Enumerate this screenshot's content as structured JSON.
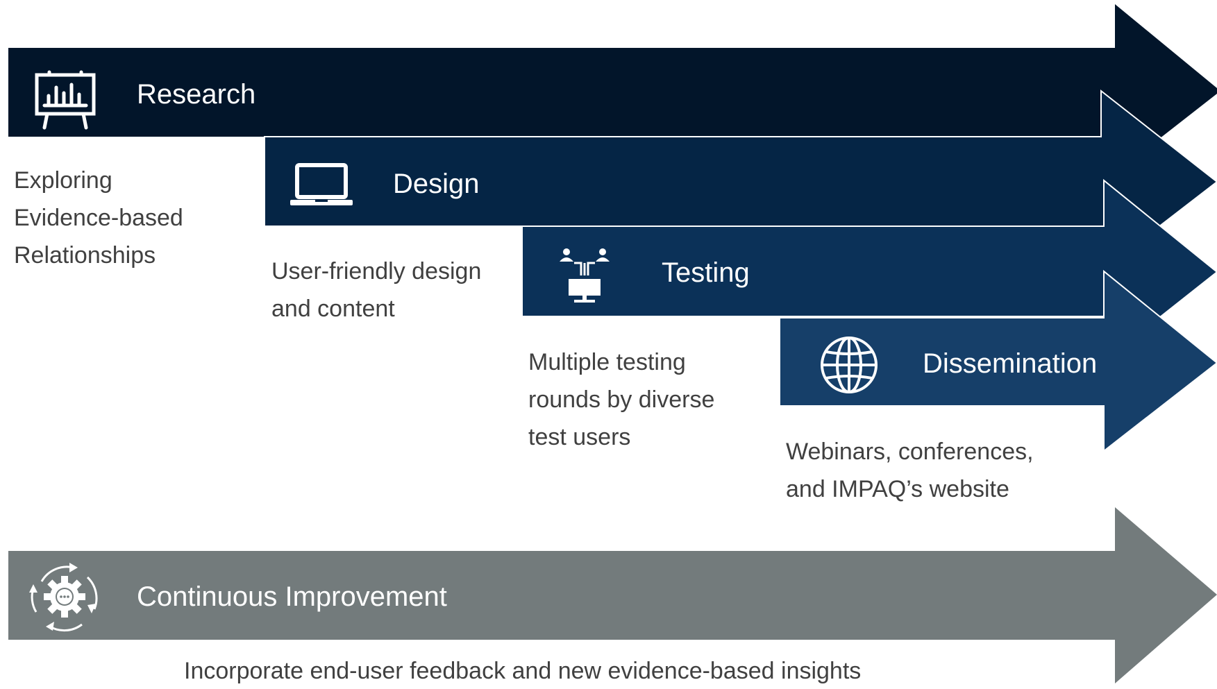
{
  "diagram": {
    "stages": [
      {
        "title": "Research",
        "icon": "presentation-chart-icon",
        "color": "#02152a",
        "description": [
          "Exploring",
          "Evidence-based",
          "Relationships"
        ]
      },
      {
        "title": "Design",
        "icon": "laptop-icon",
        "color": "#052545",
        "description": [
          "User-friendly design",
          "and content"
        ]
      },
      {
        "title": "Testing",
        "icon": "users-computer-network-icon",
        "color": "#0b3158",
        "description": [
          "Multiple testing",
          "rounds by diverse",
          "test users"
        ]
      },
      {
        "title": "Dissemination",
        "icon": "globe-icon",
        "color": "#163f69",
        "description": [
          "Webinars, conferences,",
          "and IMPAQ’s website"
        ]
      }
    ],
    "improvement": {
      "title": "Continuous Improvement",
      "icon": "gear-cycle-icon",
      "color": "#737b7c",
      "description": "Incorporate end-user feedback and new evidence-based insights"
    }
  }
}
